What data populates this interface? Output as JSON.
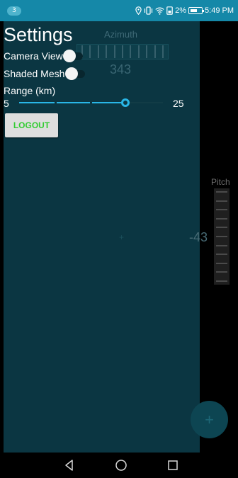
{
  "status_bar": {
    "notification_count": "3",
    "battery_percent": "2%",
    "time": "5:49 PM",
    "icons": [
      "location-icon",
      "vibrate-icon",
      "wifi-icon",
      "data-saver-icon",
      "battery-charging-icon"
    ]
  },
  "settings": {
    "title": "Settings",
    "camera_view_label": "Camera View",
    "camera_view_on": false,
    "shaded_mesh_label": "Shaded Mesh",
    "shaded_mesh_on": false,
    "range_label": "Range (km)",
    "range_min": "5",
    "range_max": "25",
    "range_value_fraction": 0.74,
    "logout_label": "LOGOUT"
  },
  "azimuth": {
    "label": "Azimuth",
    "value": "343"
  },
  "pitch": {
    "label": "Pitch",
    "value": "-43"
  },
  "fab": {
    "icon": "plus-icon",
    "symbol": "+"
  },
  "nav": {
    "back_icon": "back-triangle-icon",
    "home_icon": "home-circle-icon",
    "recents_icon": "recents-square-icon"
  },
  "colors": {
    "status_bar": "#1588a8",
    "map_background": "#0b3642",
    "slider_accent": "#29b6e6",
    "logout_text": "#33cc33"
  }
}
